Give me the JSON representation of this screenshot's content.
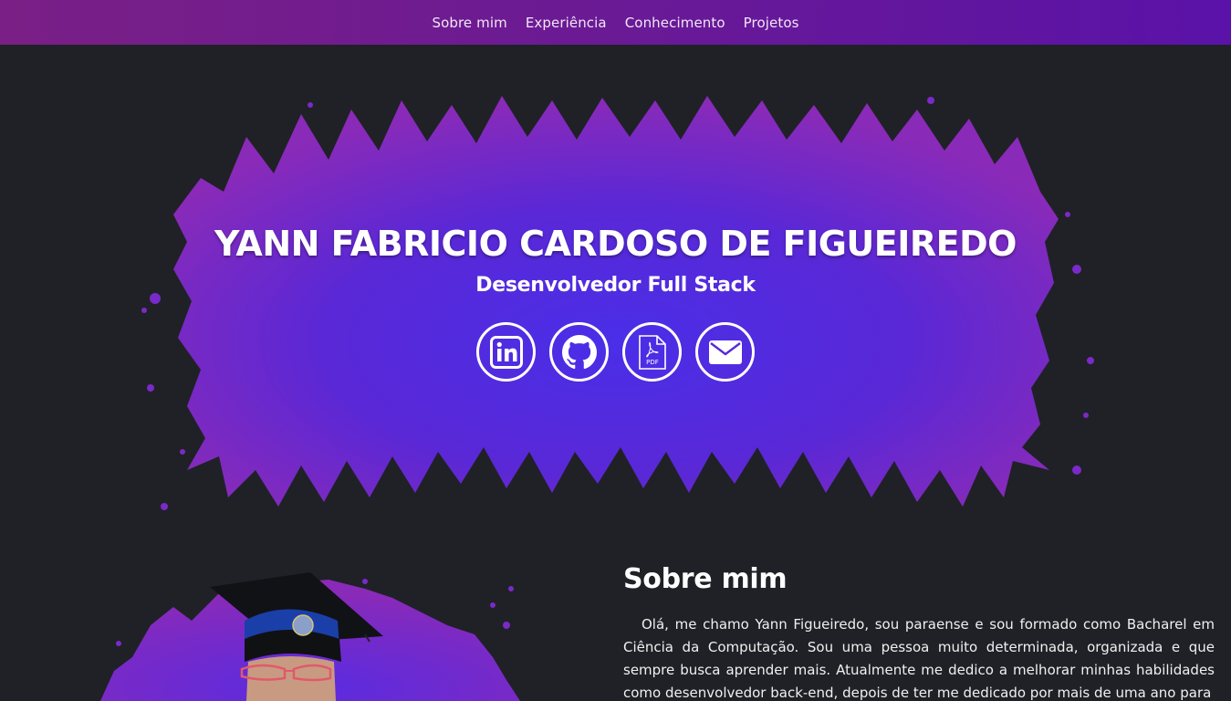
{
  "nav": {
    "items": [
      {
        "label": "Sobre mim"
      },
      {
        "label": "Experiência"
      },
      {
        "label": "Conhecimento"
      },
      {
        "label": "Projetos"
      }
    ]
  },
  "hero": {
    "name": "YANN FABRICIO CARDOSO DE FIGUEIREDO",
    "role": "Desenvolvedor Full Stack",
    "social": [
      {
        "icon": "linkedin-icon"
      },
      {
        "icon": "github-icon"
      },
      {
        "icon": "pdf-icon",
        "label": "PDF"
      },
      {
        "icon": "envelope-icon"
      }
    ]
  },
  "about": {
    "title": "Sobre mim",
    "text": "Olá, me chamo Yann Figueiredo, sou paraense e sou formado como Bacharel em Ciência da Computação. Sou uma pessoa muito determinada, organizada e que sempre busca aprender mais. Atualmente me dedico a melhorar minhas habilidades como desenvolvedor back-end, depois de ter me dedicado por mais de uma ano para"
  },
  "colors": {
    "background": "#1f2126",
    "nav_gradient_start": "#7a1f86",
    "nav_gradient_end": "#5a12a8",
    "splash_purple": "#8a2ab8",
    "splash_blue": "#4a2ee8"
  }
}
